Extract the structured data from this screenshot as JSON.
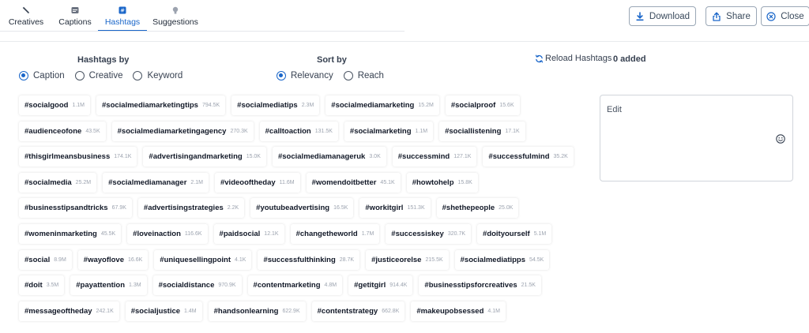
{
  "tabs": [
    {
      "label": "Creatives",
      "icon": "wand-icon"
    },
    {
      "label": "Captions",
      "icon": "caption-icon"
    },
    {
      "label": "Hashtags",
      "icon": "hashtag-icon",
      "active": true
    },
    {
      "label": "Suggestions",
      "icon": "lightbulb-icon"
    }
  ],
  "header": {
    "download_label": "Download",
    "share_label": "Share",
    "close_label": "Close"
  },
  "filters": {
    "hashtags_by": {
      "title": "Hashtags by",
      "options": [
        "Caption",
        "Creative",
        "Keyword"
      ],
      "selected": "Caption"
    },
    "sort_by": {
      "title": "Sort by",
      "options": [
        "Relevancy",
        "Reach"
      ],
      "selected": "Relevancy"
    }
  },
  "reload_label": "Reload Hashtags",
  "added_label": "0 added",
  "edit": {
    "label": "Edit"
  },
  "colors": {
    "accent": "#1a66c9",
    "text": "#1f2937",
    "muted": "#9ca3af"
  },
  "hashtags": [
    [
      {
        "tag": "#socialgood",
        "count": "1.1M"
      },
      {
        "tag": "#socialmediamarketingtips",
        "count": "794.5K"
      },
      {
        "tag": "#socialmediatips",
        "count": "2.3M"
      },
      {
        "tag": "#socialmediamarketing",
        "count": "15.2M"
      },
      {
        "tag": "#socialproof",
        "count": "15.6K"
      }
    ],
    [
      {
        "tag": "#audienceofone",
        "count": "43.5K"
      },
      {
        "tag": "#socialmediamarketingagency",
        "count": "270.3K"
      },
      {
        "tag": "#calltoaction",
        "count": "131.5K"
      },
      {
        "tag": "#socialmarketing",
        "count": "1.1M"
      },
      {
        "tag": "#sociallistening",
        "count": "17.1K"
      }
    ],
    [
      {
        "tag": "#thisgirlmeansbusiness",
        "count": "174.1K"
      },
      {
        "tag": "#advertisingandmarketing",
        "count": "15.0K"
      },
      {
        "tag": "#socialmediamanageruk",
        "count": "3.0K"
      },
      {
        "tag": "#successmind",
        "count": "127.1K"
      },
      {
        "tag": "#successfulmind",
        "count": "35.2K"
      }
    ],
    [
      {
        "tag": "#socialmedia",
        "count": "25.2M"
      },
      {
        "tag": "#socialmediamanager",
        "count": "2.1M"
      },
      {
        "tag": "#videooftheday",
        "count": "11.6M"
      },
      {
        "tag": "#womendoitbetter",
        "count": "45.1K"
      },
      {
        "tag": "#howtohelp",
        "count": "15.8K"
      }
    ],
    [
      {
        "tag": "#businesstipsandtricks",
        "count": "67.9K"
      },
      {
        "tag": "#advertisingstrategies",
        "count": "2.2K"
      },
      {
        "tag": "#youtubeadvertising",
        "count": "16.5K"
      },
      {
        "tag": "#workitgirl",
        "count": "151.3K"
      },
      {
        "tag": "#shethepeople",
        "count": "25.0K"
      }
    ],
    [
      {
        "tag": "#womeninmarketing",
        "count": "45.5K"
      },
      {
        "tag": "#loveinaction",
        "count": "116.6K"
      },
      {
        "tag": "#paidsocial",
        "count": "12.1K"
      },
      {
        "tag": "#changetheworld",
        "count": "1.7M"
      },
      {
        "tag": "#successiskey",
        "count": "320.7K"
      },
      {
        "tag": "#doityourself",
        "count": "5.1M"
      }
    ],
    [
      {
        "tag": "#social",
        "count": "8.9M"
      },
      {
        "tag": "#wayoflove",
        "count": "16.6K"
      },
      {
        "tag": "#uniquesellingpoint",
        "count": "4.1K"
      },
      {
        "tag": "#successfulthinking",
        "count": "28.7K"
      },
      {
        "tag": "#justiceorelse",
        "count": "215.5K"
      },
      {
        "tag": "#socialmediatipps",
        "count": "54.5K"
      }
    ],
    [
      {
        "tag": "#doit",
        "count": "3.5M"
      },
      {
        "tag": "#payattention",
        "count": "1.3M"
      },
      {
        "tag": "#socialdistance",
        "count": "970.9K"
      },
      {
        "tag": "#contentmarketing",
        "count": "4.8M"
      },
      {
        "tag": "#getitgirl",
        "count": "914.4K"
      },
      {
        "tag": "#businesstipsforcreatives",
        "count": "21.5K"
      }
    ],
    [
      {
        "tag": "#messageoftheday",
        "count": "242.1K"
      },
      {
        "tag": "#socialjustice",
        "count": "1.4M"
      },
      {
        "tag": "#handsonlearning",
        "count": "622.9K"
      },
      {
        "tag": "#contentstrategy",
        "count": "662.8K"
      },
      {
        "tag": "#makeupobsessed",
        "count": "4.1M"
      }
    ]
  ]
}
